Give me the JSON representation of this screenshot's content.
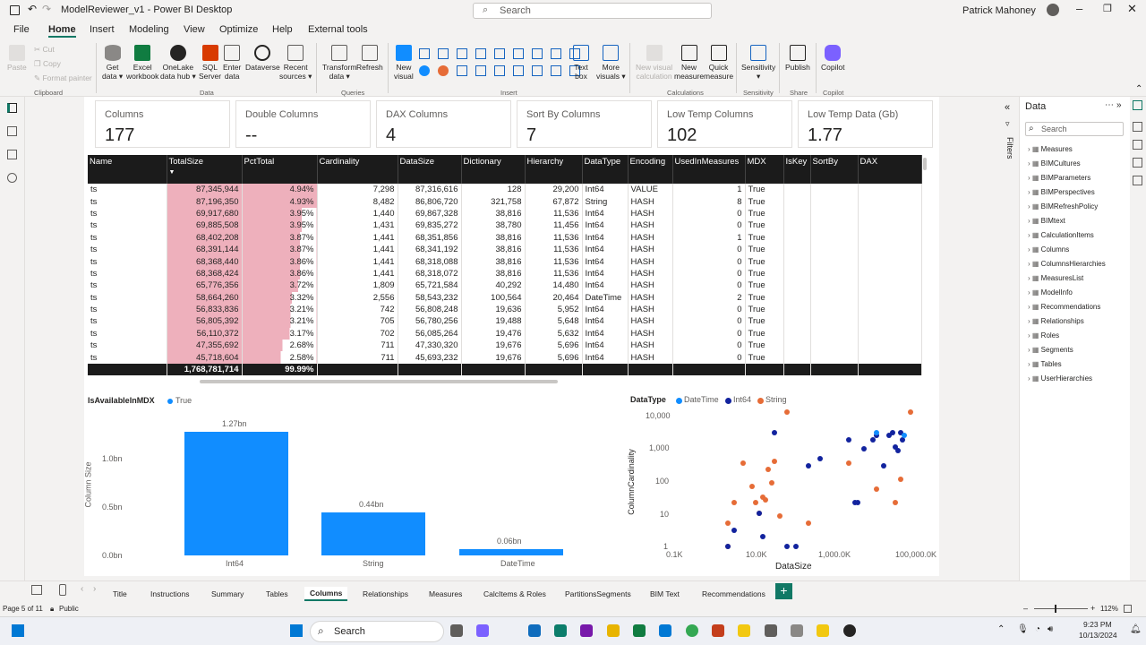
{
  "window": {
    "title": "ModelReviewer_v1 - Power BI Desktop",
    "search_placeholder": "Search",
    "user": "Patrick Mahoney"
  },
  "menu": [
    "File",
    "Home",
    "Insert",
    "Modeling",
    "View",
    "Optimize",
    "Help",
    "External tools"
  ],
  "ribbon": {
    "clipboard": {
      "paste": "Paste",
      "cut": "Cut",
      "copy": "Copy",
      "format_painter": "Format painter",
      "group": "Clipboard"
    },
    "data": {
      "get_data": [
        "Get",
        "data ▾"
      ],
      "excel": [
        "Excel",
        "workbook"
      ],
      "onelake": [
        "OneLake",
        "data hub ▾"
      ],
      "sql": [
        "SQL",
        "Server"
      ],
      "enter": [
        "Enter",
        "data"
      ],
      "dataverse": [
        "Dataverse",
        ""
      ],
      "recent": [
        "Recent",
        "sources ▾"
      ],
      "group": "Data"
    },
    "queries": {
      "transform": [
        "Transform",
        "data ▾"
      ],
      "refresh": [
        "Refresh",
        ""
      ],
      "group": "Queries"
    },
    "insert": {
      "new_visual": [
        "New",
        "visual"
      ],
      "text_box": [
        "Text",
        "box"
      ],
      "more_visuals": [
        "More",
        "visuals ▾"
      ],
      "group": "Insert"
    },
    "calculations": {
      "new_visual_calc": [
        "New visual",
        "calculation"
      ],
      "new_measure": [
        "New",
        "measure"
      ],
      "quick_measure": [
        "Quick",
        "measure"
      ],
      "group": "Calculations"
    },
    "sensitivity": {
      "label": "Sensitivity",
      "group": "Sensitivity"
    },
    "share": {
      "publish": "Publish",
      "group": "Share"
    },
    "copilot": {
      "label": "Copilot",
      "group": "Copilot"
    }
  },
  "cards": [
    {
      "label": "Columns",
      "value": "177"
    },
    {
      "label": "Double Columns",
      "value": "--"
    },
    {
      "label": "DAX Columns",
      "value": "4"
    },
    {
      "label": "Sort By Columns",
      "value": "7"
    },
    {
      "label": "Low Temp Columns",
      "value": "102"
    },
    {
      "label": "Low Temp Data (Gb)",
      "value": "1.77"
    }
  ],
  "table": {
    "headers": [
      "Name",
      "TotalSize",
      "PctTotal",
      "Cardinality",
      "DataSize",
      "Dictionary",
      "Hierarchy",
      "DataType",
      "Encoding",
      "UsedInMeasures",
      "MDX",
      "IsKey",
      "SortBy",
      "DAX"
    ],
    "rows": [
      [
        "ts",
        "87,345,944",
        "4.94%",
        "7,298",
        "87,316,616",
        "128",
        "29,200",
        "Int64",
        "VALUE",
        "1",
        "True"
      ],
      [
        "ts",
        "87,196,350",
        "4.93%",
        "8,482",
        "86,806,720",
        "321,758",
        "67,872",
        "String",
        "HASH",
        "8",
        "True"
      ],
      [
        "ts",
        "69,917,680",
        "3.95%",
        "1,440",
        "69,867,328",
        "38,816",
        "11,536",
        "Int64",
        "HASH",
        "0",
        "True"
      ],
      [
        "ts",
        "69,885,508",
        "3.95%",
        "1,431",
        "69,835,272",
        "38,780",
        "11,456",
        "Int64",
        "HASH",
        "0",
        "True"
      ],
      [
        "ts",
        "68,402,208",
        "3.87%",
        "1,441",
        "68,351,856",
        "38,816",
        "11,536",
        "Int64",
        "HASH",
        "1",
        "True"
      ],
      [
        "ts",
        "68,391,144",
        "3.87%",
        "1,441",
        "68,341,192",
        "38,816",
        "11,536",
        "Int64",
        "HASH",
        "0",
        "True"
      ],
      [
        "ts",
        "68,368,440",
        "3.86%",
        "1,441",
        "68,318,088",
        "38,816",
        "11,536",
        "Int64",
        "HASH",
        "0",
        "True"
      ],
      [
        "ts",
        "68,368,424",
        "3.86%",
        "1,441",
        "68,318,072",
        "38,816",
        "11,536",
        "Int64",
        "HASH",
        "0",
        "True"
      ],
      [
        "ts",
        "65,776,356",
        "3.72%",
        "1,809",
        "65,721,584",
        "40,292",
        "14,480",
        "Int64",
        "HASH",
        "0",
        "True"
      ],
      [
        "ts",
        "58,664,260",
        "3.32%",
        "2,556",
        "58,543,232",
        "100,564",
        "20,464",
        "DateTime",
        "HASH",
        "2",
        "True"
      ],
      [
        "ts",
        "56,833,836",
        "3.21%",
        "742",
        "56,808,248",
        "19,636",
        "5,952",
        "Int64",
        "HASH",
        "0",
        "True"
      ],
      [
        "ts",
        "56,805,392",
        "3.21%",
        "705",
        "56,780,256",
        "19,488",
        "5,648",
        "Int64",
        "HASH",
        "0",
        "True"
      ],
      [
        "ts",
        "56,110,372",
        "3.17%",
        "702",
        "56,085,264",
        "19,476",
        "5,632",
        "Int64",
        "HASH",
        "0",
        "True"
      ],
      [
        "ts",
        "47,355,692",
        "2.68%",
        "711",
        "47,330,320",
        "19,676",
        "5,696",
        "Int64",
        "HASH",
        "0",
        "True"
      ],
      [
        "ts",
        "45,718,604",
        "2.58%",
        "711",
        "45,693,232",
        "19,676",
        "5,696",
        "Int64",
        "HASH",
        "0",
        "True"
      ]
    ],
    "pct_fill": [
      0.494,
      0.493,
      0.395,
      0.395,
      0.387,
      0.387,
      0.386,
      0.386,
      0.372,
      0.332,
      0.321,
      0.321,
      0.317,
      0.268,
      0.258
    ],
    "total": {
      "total_size": "1,768,781,714",
      "pct_total": "99.99%"
    }
  },
  "bar_chart": {
    "legend_title": "IsAvailableInMDX",
    "legend_item": "True",
    "ylabel": "Column Size",
    "yticks": [
      "1.0bn",
      "0.5bn",
      "0.0bn"
    ],
    "chart_data": {
      "type": "bar",
      "categories": [
        "Int64",
        "String",
        "DateTime"
      ],
      "values": [
        1.27,
        0.44,
        0.06
      ],
      "labels": [
        "1.27bn",
        "0.44bn",
        "0.06bn"
      ],
      "ylim": [
        0,
        1.27
      ]
    }
  },
  "scatter": {
    "legend_title": "DataType",
    "legend": [
      "DateTime",
      "Int64",
      "String"
    ],
    "colors": {
      "DateTime": "#118dff",
      "Int64": "#12239e",
      "String": "#e66c37"
    },
    "xlabel": "DataSize",
    "ylabel": "ColumnCardinality",
    "xticks": [
      "0.1K",
      "10.0K",
      "1,000.0K",
      "100,000.0K"
    ],
    "yticks": [
      "10,000",
      "1,000",
      "100",
      "10",
      "1"
    ],
    "chart_data": {
      "type": "scatter",
      "x_log": true,
      "y_log": true,
      "series": [
        {
          "name": "String",
          "points": [
            [
              2,
              1
            ],
            [
              2,
              5
            ],
            [
              3,
              20
            ],
            [
              5,
              300
            ],
            [
              8,
              60
            ],
            [
              10,
              20
            ],
            [
              12,
              10
            ],
            [
              15,
              30
            ],
            [
              18,
              25
            ],
            [
              20,
              200
            ],
            [
              25,
              80
            ],
            [
              30,
              350
            ],
            [
              40,
              8
            ],
            [
              60,
              12000
            ],
            [
              200,
              5
            ],
            [
              2000,
              300
            ],
            [
              10000,
              50
            ],
            [
              30000,
              20
            ],
            [
              40000,
              100
            ],
            [
              70000,
              15000
            ]
          ]
        },
        {
          "name": "Int64",
          "points": [
            [
              3,
              3
            ],
            [
              2,
              1
            ],
            [
              12,
              10
            ],
            [
              15,
              2
            ],
            [
              30,
              2500
            ],
            [
              60,
              1
            ],
            [
              100,
              1
            ],
            [
              200,
              250
            ],
            [
              400,
              400
            ],
            [
              2000,
              1500
            ],
            [
              3000,
              20
            ],
            [
              3500,
              20
            ],
            [
              5000,
              800
            ],
            [
              8000,
              1500
            ],
            [
              10000,
              2000
            ],
            [
              15000,
              250
            ],
            [
              20000,
              2000
            ],
            [
              25000,
              2500
            ],
            [
              30000,
              900
            ],
            [
              35000,
              700
            ],
            [
              40000,
              2500
            ],
            [
              45000,
              1500
            ]
          ]
        },
        {
          "name": "DateTime",
          "points": [
            [
              10000,
              2500
            ],
            [
              50000,
              2000
            ]
          ]
        }
      ]
    }
  },
  "data_pane": {
    "title": "Data",
    "search": "Search",
    "filters": "Filters",
    "items": [
      "Measures",
      "BIMCultures",
      "BIMParameters",
      "BIMPerspectives",
      "BIMRefreshPolicy",
      "BIMtext",
      "CalculationItems",
      "Columns",
      "ColumnsHierarchies",
      "MeasuresList",
      "ModelInfo",
      "Recommendations",
      "Relationships",
      "Roles",
      "Segments",
      "Tables",
      "UserHierarchies"
    ]
  },
  "tabs": [
    "Title",
    "Instructions",
    "Summary",
    "Tables",
    "Columns",
    "Relationships",
    "Measures",
    "CalcItems & Roles",
    "PartitionsSegments",
    "BIM Text",
    "Recommendations"
  ],
  "active_tab": "Columns",
  "status": {
    "page": "Page 5 of 11",
    "public": "Public",
    "zoom": "112%"
  },
  "taskbar": {
    "search": "Search",
    "time": "9:23 PM",
    "date": "10/13/2024"
  }
}
